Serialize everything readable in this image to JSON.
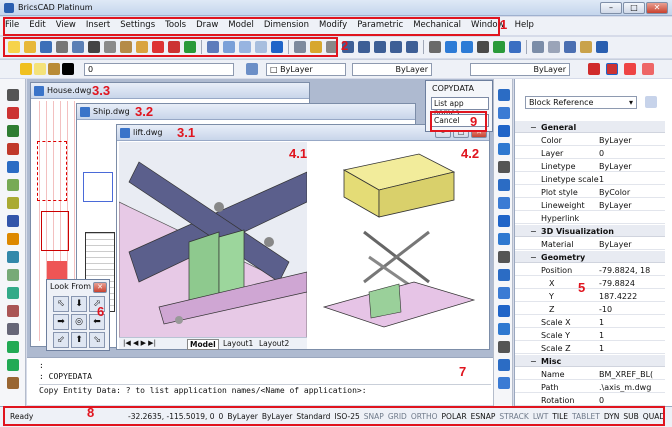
{
  "app": {
    "title": "BricsCAD Platinum"
  },
  "menu": [
    "File",
    "Edit",
    "View",
    "Insert",
    "Settings",
    "Tools",
    "Draw",
    "Model",
    "Dimension",
    "Modify",
    "Parametric",
    "Mechanical",
    "Window",
    "Help"
  ],
  "callouts": {
    "c1": "1",
    "c2": "2",
    "c31": "3.1",
    "c32": "3.2",
    "c33": "3.3",
    "c41": "4.1",
    "c42": "4.2",
    "c5": "5",
    "c6": "6",
    "c7": "7",
    "c8": "8",
    "c9": "9"
  },
  "layerbar": {
    "layer": "0",
    "color": "ByLayer",
    "linetype": "ByLayer",
    "lineweight": "ByLayer"
  },
  "docs": {
    "house": "House.dwg",
    "ship": "Ship.dwg",
    "lift": "lift.dwg"
  },
  "layout_tabs": [
    "Model",
    "Layout1",
    "Layout2"
  ],
  "copydata": {
    "title": "COPYDATA",
    "list": "List app names",
    "cancel": "Cancel"
  },
  "lookfrom": {
    "title": "Look From"
  },
  "properties": {
    "selection": "Block Reference",
    "sections": [
      {
        "name": "General",
        "rows": [
          [
            "Color",
            "ByLayer"
          ],
          [
            "Layer",
            "0"
          ],
          [
            "Linetype",
            "ByLayer"
          ],
          [
            "Linetype scale",
            "1"
          ],
          [
            "Plot style",
            "ByColor"
          ],
          [
            "Lineweight",
            "ByLayer"
          ],
          [
            "Hyperlink",
            ""
          ]
        ]
      },
      {
        "name": "3D Visualization",
        "rows": [
          [
            "Material",
            "ByLayer"
          ]
        ]
      },
      {
        "name": "Geometry",
        "rows": [
          [
            "Position",
            "-79.8824, 18"
          ],
          [
            "X",
            "-79.8824"
          ],
          [
            "Y",
            "187.4222"
          ],
          [
            "Z",
            "-10"
          ],
          [
            "Scale X",
            "1"
          ],
          [
            "Scale Y",
            "1"
          ],
          [
            "Scale Z",
            "1"
          ]
        ]
      },
      {
        "name": "Misc",
        "rows": [
          [
            "Name",
            "BM_XREF_BL("
          ],
          [
            "Path",
            ".\\axis_m.dwg"
          ],
          [
            "Rotation",
            "0"
          ]
        ]
      }
    ]
  },
  "command": {
    "line1": ":",
    "line2": ": COPYEDATA",
    "line3": "Copy Entity Data:  ? to list application names/<Name of application>:"
  },
  "status": {
    "ready": "Ready",
    "coords": "-32.2635, -115.5019, 0",
    "items": [
      "0",
      "ByLayer",
      "ByLayer",
      "Standard",
      "ISO-25"
    ],
    "toggles": [
      [
        "SNAP",
        false
      ],
      [
        "GRID",
        false
      ],
      [
        "ORTHO",
        false
      ],
      [
        "POLAR",
        true
      ],
      [
        "ESNAP",
        true
      ],
      [
        "STRACK",
        false
      ],
      [
        "LWT",
        false
      ],
      [
        "TILE",
        true
      ],
      [
        "TABLET",
        false
      ],
      [
        "DYN",
        true
      ],
      [
        "SUB",
        true
      ],
      [
        "QUAD",
        true
      ]
    ]
  },
  "colors": {
    "accent": "#e0141e",
    "selection_blue": "#1f64c8",
    "ui_bg": "#d6dbe9"
  }
}
